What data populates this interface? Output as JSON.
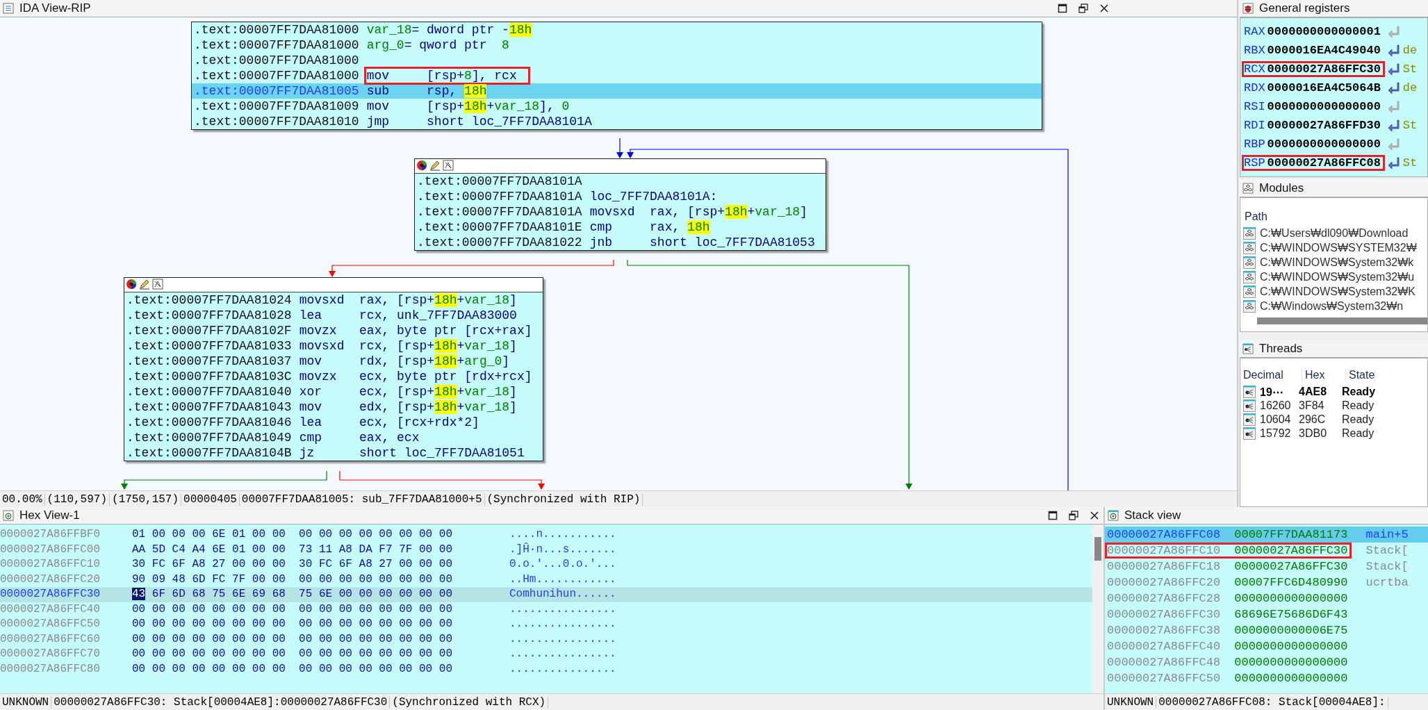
{
  "ida_view": {
    "title": "IDA View-RIP",
    "nodes": [
      {
        "toolbar": false,
        "lines": [
          {
            "address": ".text:00007FF7DAA81000",
            "selected": false,
            "outlined": false,
            "code": [
              {
                "text": "var_18",
                "kind": "variable"
              },
              {
                "text": "= dword ptr -",
                "kind": "plain"
              },
              {
                "text": "18h",
                "kind": "highlight"
              }
            ]
          },
          {
            "address": ".text:00007FF7DAA81000",
            "selected": false,
            "outlined": false,
            "code": [
              {
                "text": "arg_0",
                "kind": "variable"
              },
              {
                "text": "= qword ptr  ",
                "kind": "plain"
              },
              {
                "text": "8",
                "kind": "number"
              }
            ]
          },
          {
            "address": ".text:00007FF7DAA81000",
            "selected": false,
            "outlined": false
          },
          {
            "address": ".text:00007FF7DAA81000",
            "selected": false,
            "outlined": true,
            "code": [
              {
                "text": "mov     [rsp+",
                "kind": "plain"
              },
              {
                "text": "8",
                "kind": "number"
              },
              {
                "text": "], rcx",
                "kind": "plain"
              }
            ]
          },
          {
            "address": ".text:00007FF7DAA81005",
            "selected": true,
            "outlined": false,
            "code": [
              {
                "text": "sub     rsp, ",
                "kind": "plain"
              },
              {
                "text": "18h",
                "kind": "highlight"
              }
            ]
          },
          {
            "address": ".text:00007FF7DAA81009",
            "selected": false,
            "outlined": false,
            "code": [
              {
                "text": "mov     [rsp+",
                "kind": "plain"
              },
              {
                "text": "18h",
                "kind": "highlight"
              },
              {
                "text": "+",
                "kind": "plain"
              },
              {
                "text": "var_18",
                "kind": "variable"
              },
              {
                "text": "], ",
                "kind": "plain"
              },
              {
                "text": "0",
                "kind": "number"
              }
            ]
          },
          {
            "address": ".text:00007FF7DAA81010",
            "selected": false,
            "outlined": false,
            "code": [
              {
                "text": "jmp     short loc_7FF7DAA8101A",
                "kind": "plain"
              }
            ]
          }
        ]
      },
      {
        "toolbar": true,
        "lines": [
          {
            "address": ".text:00007FF7DAA8101A",
            "selected": false,
            "outlined": false
          },
          {
            "address": ".text:00007FF7DAA8101A",
            "selected": false,
            "outlined": false,
            "code": [
              {
                "text": "loc_7FF7DAA8101A:",
                "kind": "plain"
              }
            ]
          },
          {
            "address": ".text:00007FF7DAA8101A",
            "selected": false,
            "outlined": false,
            "code": [
              {
                "text": "movsxd  rax, [rsp+",
                "kind": "plain"
              },
              {
                "text": "18h",
                "kind": "highlight"
              },
              {
                "text": "+",
                "kind": "plain"
              },
              {
                "text": "var_18",
                "kind": "variable"
              },
              {
                "text": "]",
                "kind": "plain"
              }
            ]
          },
          {
            "address": ".text:00007FF7DAA8101E",
            "selected": false,
            "outlined": false,
            "code": [
              {
                "text": "cmp     rax, ",
                "kind": "plain"
              },
              {
                "text": "18h",
                "kind": "highlight"
              }
            ]
          },
          {
            "address": ".text:00007FF7DAA81022",
            "selected": false,
            "outlined": false,
            "code": [
              {
                "text": "jnb     short loc_7FF7DAA81053",
                "kind": "plain"
              }
            ]
          }
        ]
      },
      {
        "toolbar": true,
        "lines": [
          {
            "address": ".text:00007FF7DAA81024",
            "selected": false,
            "outlined": false,
            "code": [
              {
                "text": "movsxd  rax, [rsp+",
                "kind": "plain"
              },
              {
                "text": "18h",
                "kind": "highlight"
              },
              {
                "text": "+",
                "kind": "plain"
              },
              {
                "text": "var_18",
                "kind": "variable"
              },
              {
                "text": "]",
                "kind": "plain"
              }
            ]
          },
          {
            "address": ".text:00007FF7DAA81028",
            "selected": false,
            "outlined": false,
            "code": [
              {
                "text": "lea     rcx, unk_7FF7DAA83000",
                "kind": "plain"
              }
            ]
          },
          {
            "address": ".text:00007FF7DAA8102F",
            "selected": false,
            "outlined": false,
            "code": [
              {
                "text": "movzx   eax, byte ptr [rcx+rax]",
                "kind": "plain"
              }
            ]
          },
          {
            "address": ".text:00007FF7DAA81033",
            "selected": false,
            "outlined": false,
            "code": [
              {
                "text": "movsxd  rcx, [rsp+",
                "kind": "plain"
              },
              {
                "text": "18h",
                "kind": "highlight"
              },
              {
                "text": "+",
                "kind": "plain"
              },
              {
                "text": "var_18",
                "kind": "variable"
              },
              {
                "text": "]",
                "kind": "plain"
              }
            ]
          },
          {
            "address": ".text:00007FF7DAA81037",
            "selected": false,
            "outlined": false,
            "code": [
              {
                "text": "mov     rdx, [rsp+",
                "kind": "plain"
              },
              {
                "text": "18h",
                "kind": "highlight"
              },
              {
                "text": "+",
                "kind": "plain"
              },
              {
                "text": "arg_0",
                "kind": "variable"
              },
              {
                "text": "]",
                "kind": "plain"
              }
            ]
          },
          {
            "address": ".text:00007FF7DAA8103C",
            "selected": false,
            "outlined": false,
            "code": [
              {
                "text": "movzx   ecx, byte ptr [rdx+rcx]",
                "kind": "plain"
              }
            ]
          },
          {
            "address": ".text:00007FF7DAA81040",
            "selected": false,
            "outlined": false,
            "code": [
              {
                "text": "xor     ecx, [rsp+",
                "kind": "plain"
              },
              {
                "text": "18h",
                "kind": "highlight"
              },
              {
                "text": "+",
                "kind": "plain"
              },
              {
                "text": "var_18",
                "kind": "variable"
              },
              {
                "text": "]",
                "kind": "plain"
              }
            ]
          },
          {
            "address": ".text:00007FF7DAA81043",
            "selected": false,
            "outlined": false,
            "code": [
              {
                "text": "mov     edx, [rsp+",
                "kind": "plain"
              },
              {
                "text": "18h",
                "kind": "highlight"
              },
              {
                "text": "+",
                "kind": "plain"
              },
              {
                "text": "var_18",
                "kind": "variable"
              },
              {
                "text": "]",
                "kind": "plain"
              }
            ]
          },
          {
            "address": ".text:00007FF7DAA81046",
            "selected": false,
            "outlined": false,
            "code": [
              {
                "text": "lea     ecx, [rcx+rdx*2]",
                "kind": "plain"
              }
            ]
          },
          {
            "address": ".text:00007FF7DAA81049",
            "selected": false,
            "outlined": false,
            "code": [
              {
                "text": "cmp     eax, ecx",
                "kind": "plain"
              }
            ]
          },
          {
            "address": ".text:00007FF7DAA8104B",
            "selected": false,
            "outlined": false,
            "code": [
              {
                "text": "jz      short loc_7FF7DAA81051",
                "kind": "plain"
              }
            ]
          }
        ]
      }
    ],
    "status_bar": [
      "00.00%",
      "(110,597)",
      "(1750,157)",
      "00000405",
      "00007FF7DAA81005: sub_7FF7DAA81000+5",
      "(Synchronized with RIP)"
    ]
  },
  "registers": {
    "title": "General registers",
    "rows": [
      {
        "name": "RAX",
        "value": "0000000000000001",
        "pointer": false,
        "outlined": false
      },
      {
        "name": "RBX",
        "value": "0000016EA4C49040",
        "pointer": true,
        "hint": "de",
        "outlined": false
      },
      {
        "name": "RCX",
        "value": "00000027A86FFC30",
        "pointer": true,
        "hint": "St",
        "outlined": true
      },
      {
        "name": "RDX",
        "value": "0000016EA4C5064B",
        "pointer": true,
        "hint": "de",
        "outlined": false
      },
      {
        "name": "RSI",
        "value": "0000000000000000",
        "pointer": false,
        "outlined": false
      },
      {
        "name": "RDI",
        "value": "00000027A86FFD30",
        "pointer": true,
        "hint": "St",
        "outlined": false
      },
      {
        "name": "RBP",
        "value": "0000000000000000",
        "pointer": false,
        "outlined": false
      },
      {
        "name": "RSP",
        "value": "00000027A86FFC08",
        "pointer": true,
        "hint": "St",
        "outlined": true
      }
    ]
  },
  "modules": {
    "title": "Modules",
    "column": "Path",
    "rows": [
      "C:₩Users₩dl090₩Download",
      "C:₩WINDOWS₩SYSTEM32₩",
      "C:₩WINDOWS₩System32₩k",
      "C:₩WINDOWS₩System32₩u",
      "C:₩WINDOWS₩System32₩K",
      "C:₩Windows₩System32₩n"
    ]
  },
  "threads": {
    "title": "Threads",
    "columns": [
      "Decimal",
      "Hex",
      "State"
    ],
    "rows": [
      {
        "decimal": "19⋯",
        "hex": "4AE8",
        "state": "Ready",
        "selected": true
      },
      {
        "decimal": "16260",
        "hex": "3F84",
        "state": "Ready",
        "selected": false
      },
      {
        "decimal": "10604",
        "hex": "296C",
        "state": "Ready",
        "selected": false
      },
      {
        "decimal": "15792",
        "hex": "3DB0",
        "state": "Ready",
        "selected": false
      }
    ]
  },
  "hex_view": {
    "title": "Hex View-1",
    "rows": [
      {
        "address": "0000027A86FFBF0",
        "bytes": [
          "01",
          "00",
          "00",
          "00",
          "6E",
          "01",
          "00",
          "00",
          "00",
          "00",
          "00",
          "00",
          "00",
          "00",
          "00",
          "00"
        ],
        "ascii": "....n...........",
        "selected": false,
        "cursor": false
      },
      {
        "address": "0000027A86FFC00",
        "bytes": [
          "AA",
          "5D",
          "C4",
          "A4",
          "6E",
          "01",
          "00",
          "00",
          "73",
          "11",
          "A8",
          "DA",
          "F7",
          "7F",
          "00",
          "00"
        ],
        "ascii": ".]Ĥ·n...s.......",
        "selected": false,
        "cursor": false
      },
      {
        "address": "0000027A86FFC10",
        "bytes": [
          "30",
          "FC",
          "6F",
          "A8",
          "27",
          "00",
          "00",
          "00",
          "30",
          "FC",
          "6F",
          "A8",
          "27",
          "00",
          "00",
          "00"
        ],
        "ascii": "0.o.'...0.o.'...",
        "selected": false,
        "cursor": false
      },
      {
        "address": "0000027A86FFC20",
        "bytes": [
          "90",
          "09",
          "48",
          "6D",
          "FC",
          "7F",
          "00",
          "00",
          "00",
          "00",
          "00",
          "00",
          "00",
          "00",
          "00",
          "00"
        ],
        "ascii": "..Hm............",
        "selected": false,
        "cursor": false
      },
      {
        "address": "0000027A86FFC30",
        "bytes": [
          "43",
          "6F",
          "6D",
          "68",
          "75",
          "6E",
          "69",
          "68",
          "75",
          "6E",
          "00",
          "00",
          "00",
          "00",
          "00",
          "00"
        ],
        "ascii": "Comhunihun......",
        "selected": true,
        "cursor": true
      },
      {
        "address": "0000027A86FFC40",
        "bytes": [
          "00",
          "00",
          "00",
          "00",
          "00",
          "00",
          "00",
          "00",
          "00",
          "00",
          "00",
          "00",
          "00",
          "00",
          "00",
          "00"
        ],
        "ascii": "................",
        "selected": false,
        "cursor": false
      },
      {
        "address": "0000027A86FFC50",
        "bytes": [
          "00",
          "00",
          "00",
          "00",
          "00",
          "00",
          "00",
          "00",
          "00",
          "00",
          "00",
          "00",
          "00",
          "00",
          "00",
          "00"
        ],
        "ascii": "................",
        "selected": false,
        "cursor": false
      },
      {
        "address": "0000027A86FFC60",
        "bytes": [
          "00",
          "00",
          "00",
          "00",
          "00",
          "00",
          "00",
          "00",
          "00",
          "00",
          "00",
          "00",
          "00",
          "00",
          "00",
          "00"
        ],
        "ascii": "................",
        "selected": false,
        "cursor": false
      },
      {
        "address": "0000027A86FFC70",
        "bytes": [
          "00",
          "00",
          "00",
          "00",
          "00",
          "00",
          "00",
          "00",
          "00",
          "00",
          "00",
          "00",
          "00",
          "00",
          "00",
          "00"
        ],
        "ascii": "................",
        "selected": false,
        "cursor": false
      },
      {
        "address": "0000027A86FFC80",
        "bytes": [
          "00",
          "00",
          "00",
          "00",
          "00",
          "00",
          "00",
          "00",
          "00",
          "00",
          "00",
          "00",
          "00",
          "00",
          "00",
          "00"
        ],
        "ascii": "................",
        "selected": false,
        "cursor": false
      }
    ],
    "status_bar": [
      "UNKNOWN",
      "00000027A86FFC30: Stack[00004AE8]:00000027A86FFC30",
      "(Synchronized with RCX)"
    ]
  },
  "stack_view": {
    "title": "Stack view",
    "rows": [
      {
        "address": "00000027A86FFC08",
        "value": "00007FF7DAA81173",
        "comment": "main+5",
        "selected": true,
        "outlined": false
      },
      {
        "address": "00000027A86FFC10",
        "value": "00000027A86FFC30",
        "comment": "Stack[",
        "selected": false,
        "outlined": true
      },
      {
        "address": "00000027A86FFC18",
        "value": "00000027A86FFC30",
        "comment": "Stack[",
        "selected": false,
        "outlined": false
      },
      {
        "address": "00000027A86FFC20",
        "value": "00007FFC6D480990",
        "comment": "ucrtba",
        "selected": false,
        "outlined": false
      },
      {
        "address": "00000027A86FFC28",
        "value": "0000000000000000",
        "selected": false,
        "outlined": false
      },
      {
        "address": "00000027A86FFC30",
        "value": "68696E75686D6F43",
        "selected": false,
        "outlined": false
      },
      {
        "address": "00000027A86FFC38",
        "value": "0000000000006E75",
        "selected": false,
        "outlined": false
      },
      {
        "address": "00000027A86FFC40",
        "value": "0000000000000000",
        "selected": false,
        "outlined": false
      },
      {
        "address": "00000027A86FFC48",
        "value": "0000000000000000",
        "selected": false,
        "outlined": false
      },
      {
        "address": "00000027A86FFC50",
        "value": "0000000000000000",
        "selected": false,
        "outlined": false
      }
    ],
    "status_bar": [
      "UNKNOWN",
      "00000027A86FFC08: Stack[00004AE8]:"
    ]
  }
}
